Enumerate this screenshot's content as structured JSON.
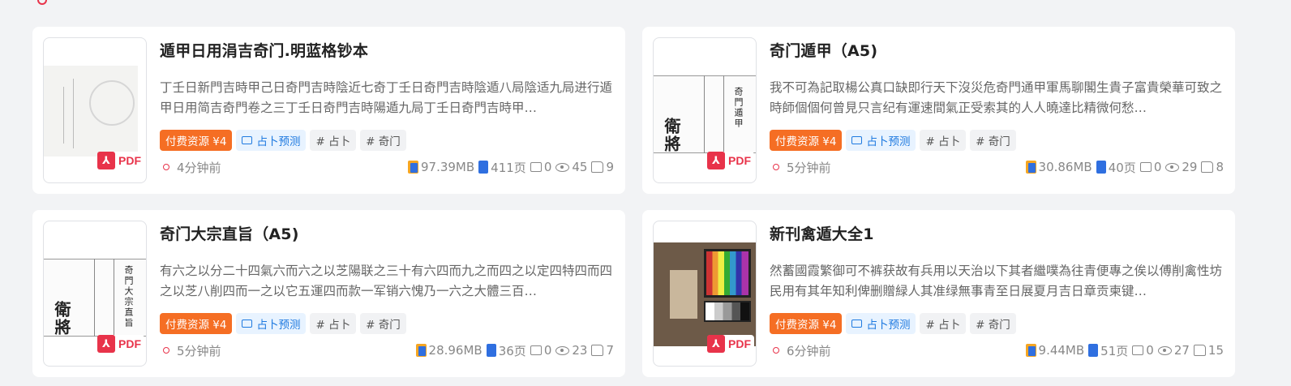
{
  "cards": [
    {
      "title": "遁甲日用涓吉奇门.明蓝格钞本",
      "description": "丁壬日新門吉時甲己日奇門吉時陰近七奇丁壬日奇門吉時陰遁八局陰适九局进行遁甲日用简吉奇門卷之三丁壬日奇門吉時陽遁九局丁壬日奇門吉時甲…",
      "paid_label": "付费资源 ¥4",
      "category_label": "占卜预测",
      "tags": [
        "# 占卜",
        "# 奇门"
      ],
      "time": "4分钟前",
      "size": "97.39MB",
      "pages": "411页",
      "comments": "0",
      "views": "45",
      "likes": "9",
      "badge": "PDF"
    },
    {
      "title": "奇门遁甲（A5)",
      "description": "我不可為記取楊公真口缺即行天下沒災危奇門通甲軍馬聊閣生貴子富貴榮華可致之時師個個何曾見只言纪有運速間氣正受索其的人人曉達比精微何愁…",
      "paid_label": "付费资源 ¥4",
      "category_label": "占卜预测",
      "tags": [
        "# 占卜",
        "# 奇门"
      ],
      "time": "5分钟前",
      "size": "30.86MB",
      "pages": "40页",
      "comments": "0",
      "views": "29",
      "likes": "8",
      "badge": "PDF"
    },
    {
      "title": "奇门大宗直旨（A5)",
      "description": "有六之以分二十四氣六而六之以芝陽联之三十有六四而九之而四之以定四特四而四之以芝八削四而一之以它五運四而款一军销六愧乃一六之大體三百…",
      "paid_label": "付费资源 ¥4",
      "category_label": "占卜预测",
      "tags": [
        "# 占卜",
        "# 奇门"
      ],
      "time": "5分钟前",
      "size": "28.96MB",
      "pages": "36页",
      "comments": "0",
      "views": "23",
      "likes": "7",
      "badge": "PDF"
    },
    {
      "title": "新刊禽遁大全1",
      "description": "然蓄國霞繁御可不裤获故有兵用以天治以下其者繼噗為往青便專之俟以傅削禽性坊民用有其年知利俾删贈緑人其准绿無事青至日展夏月吉日章贡柬键…",
      "paid_label": "付费资源 ¥4",
      "category_label": "占卜预测",
      "tags": [
        "# 占卜",
        "# 奇门"
      ],
      "time": "6分钟前",
      "size": "9.44MB",
      "pages": "51页",
      "comments": "0",
      "views": "27",
      "likes": "15",
      "badge": "PDF"
    }
  ],
  "colors": {
    "accent": "#e8334a",
    "paid": "#f56e24",
    "category": "#1f7ae0",
    "background": "#f2f3f5"
  }
}
